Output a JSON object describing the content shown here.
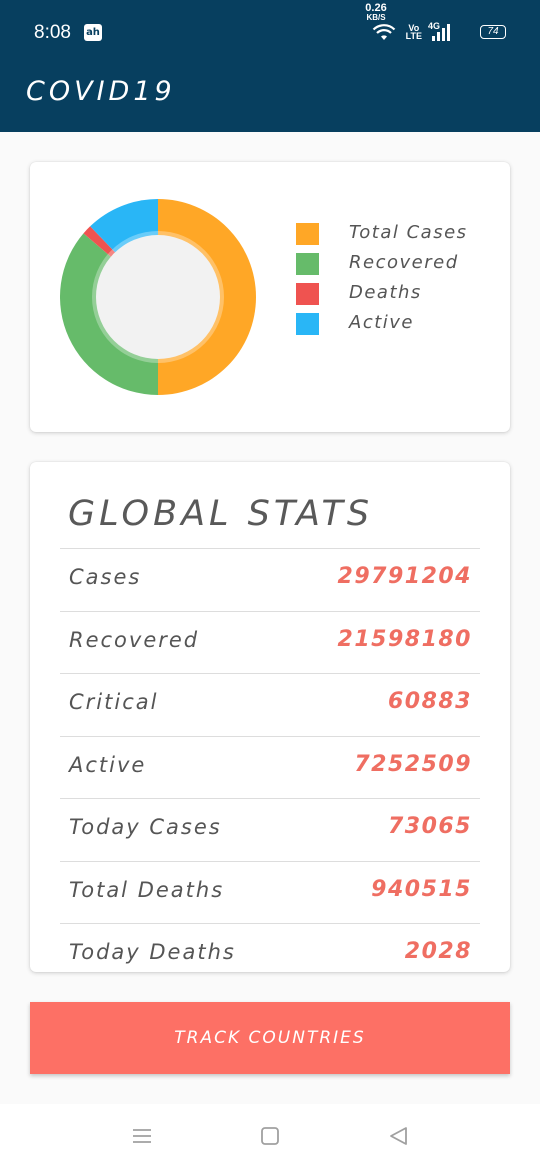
{
  "status_bar": {
    "time": "8:08",
    "app_icon_text": "ah",
    "net_speed": "0.26",
    "net_speed_unit": "KB/S",
    "volte_top": "Vo",
    "volte_bottom": "LTE",
    "network": "4G",
    "battery": "74"
  },
  "toolbar": {
    "title": "COVID19"
  },
  "chart_data": {
    "type": "pie",
    "style": "donut",
    "categories": [
      "Total Cases",
      "Recovered",
      "Deaths",
      "Active"
    ],
    "values": [
      29791204,
      21598180,
      940515,
      7252509
    ],
    "colors": [
      "#ffa726",
      "#66bb6a",
      "#ef5350",
      "#29b6f6"
    ],
    "legend_position": "right"
  },
  "legend": {
    "items": [
      {
        "label": "Total Cases",
        "color": "#ffa726"
      },
      {
        "label": "Recovered",
        "color": "#66bb6a"
      },
      {
        "label": "Deaths",
        "color": "#ef5350"
      },
      {
        "label": "Active",
        "color": "#29b6f6"
      }
    ]
  },
  "global_stats": {
    "title": "GLOBAL STATS",
    "rows": [
      {
        "label": "Cases",
        "value": "29791204"
      },
      {
        "label": "Recovered",
        "value": "21598180"
      },
      {
        "label": "Critical",
        "value": "60883"
      },
      {
        "label": "Active",
        "value": "7252509"
      },
      {
        "label": "Today Cases",
        "value": "73065"
      },
      {
        "label": "Total Deaths",
        "value": "940515"
      },
      {
        "label": "Today Deaths",
        "value": "2028"
      }
    ]
  },
  "track_button": {
    "label": "TRACK COUNTRIES"
  },
  "colors": {
    "toolbar": "#073f5f",
    "accent": "#fd7065",
    "value_text": "#ef6e62"
  },
  "nav_bar": {
    "icons": [
      "menu-icon",
      "home-icon",
      "back-icon"
    ]
  }
}
